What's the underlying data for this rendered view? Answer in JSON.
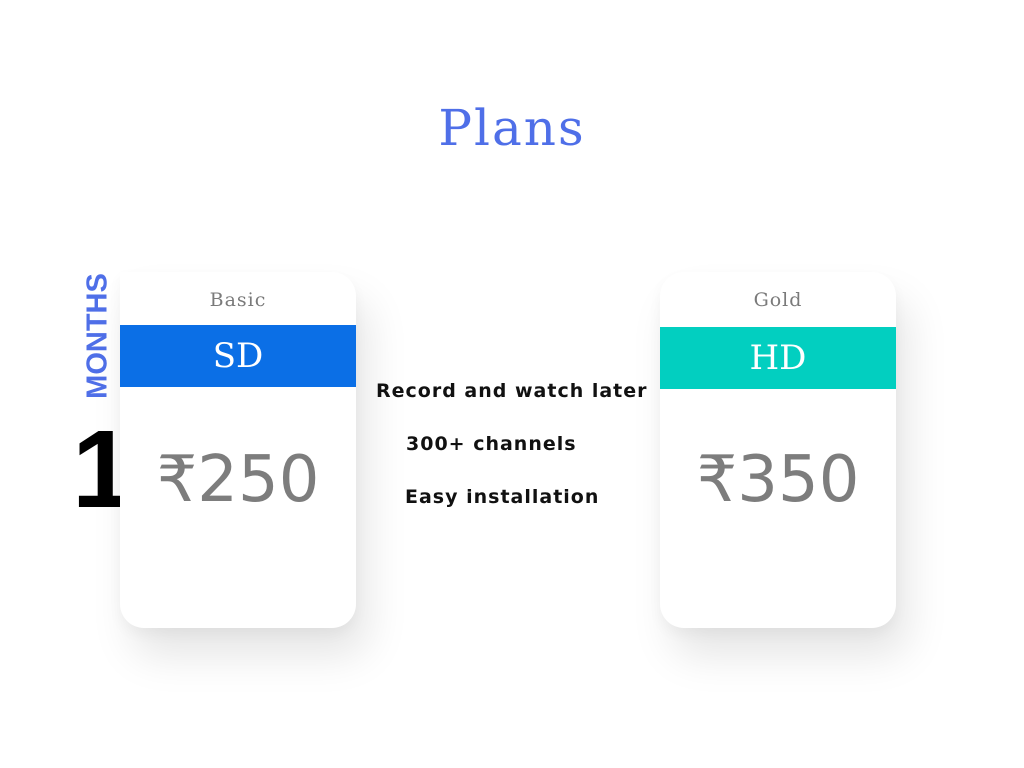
{
  "title": "Plans",
  "duration": {
    "number": "1",
    "unit": "MONTHS"
  },
  "plans": [
    {
      "tier": "Basic",
      "quality": "SD",
      "price": "₹250",
      "band_color": "#0b6fe6"
    },
    {
      "tier": "Gold",
      "quality": "HD",
      "price": "₹350",
      "band_color": "#02cfc0"
    }
  ],
  "features": [
    "Record and watch later",
    "300+ channels",
    "Easy installation"
  ],
  "colors": {
    "accent": "#4f6fe8",
    "price_text": "#7d7d7d"
  }
}
